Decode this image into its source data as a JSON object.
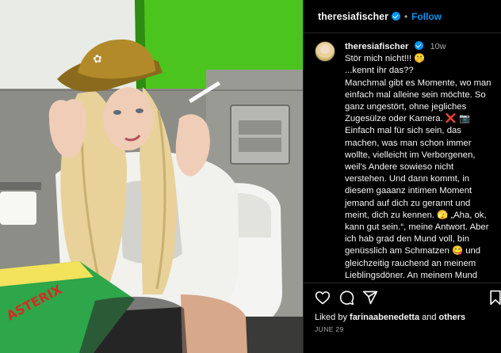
{
  "header": {
    "username": "theresiafischer",
    "follow_label": "Follow",
    "separator": "•"
  },
  "caption": {
    "username": "theresiafischer",
    "age": "10w",
    "lines": [
      "Stör mich nicht!!! 🤫",
      "...kennt ihr das??",
      "Manchmal gibt es Momente, wo man einfach mal alleine sein möchte. So ganz ungestört, ohne jegliches Zugesülze oder Kamera. ❌ 📷",
      "Einfach mal für sich sein, das machen, was man schon immer wollte, vielleicht im Verborgenen, weil's Andere sowieso nicht verstehen. Und dann kommt, in diesem gaaanz intimen Moment jemand auf dich zu gerannt und meint, dich zu kennen. 🫣 „Aha, ok, kann gut sein.“, meine Antwort. Aber ich hab grad den Mund voll, bin genüsslich am Schmatzen 😋 und gleichzeitig rauchend an meinem Lieblingsdöner. An meinem Mund tropft noch die Chillisoße hinab und mein Atem erfrischt den Anwesenden mit einem"
    ]
  },
  "likes": {
    "prefix": "Liked by ",
    "user": "farinaabenedetta",
    "suffix": " and ",
    "others": "others"
  },
  "date": "JUNE 29",
  "icons": {
    "verified": "verified-badge-icon",
    "like": "heart-icon",
    "comment": "comment-icon",
    "share": "paper-plane-icon",
    "save": "bookmark-icon"
  },
  "media": {
    "cap_logo": "adidas trefoil"
  },
  "colors": {
    "background": "#000000",
    "accent": "#0095f6",
    "text": "#f5f5f5",
    "muted": "#a8a8a8",
    "wall_green": "#4cc41e",
    "cap_gold": "#b28a2a",
    "comic_green": "#2ea64a"
  }
}
